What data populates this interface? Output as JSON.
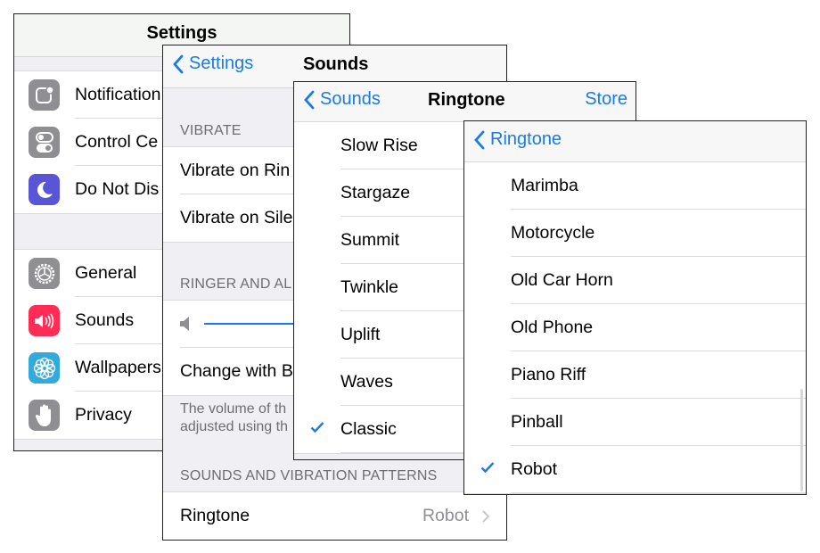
{
  "colors": {
    "accent": "#1a7ae6",
    "notifications_icon": "#8e8e93",
    "control_center_icon": "#8e8e93",
    "do_not_disturb_icon": "#5856d6",
    "general_icon": "#8e8e93",
    "sounds_icon": "#ff2d55",
    "wallpapers_icon": "#34aadc",
    "privacy_icon": "#8e8e93"
  },
  "settings": {
    "title": "Settings",
    "group1": [
      {
        "label": "Notification",
        "icon": "notifications-icon"
      },
      {
        "label": "Control Ce",
        "icon": "control-center-icon"
      },
      {
        "label": "Do Not Dis",
        "icon": "moon-icon"
      }
    ],
    "group2": [
      {
        "label": "General",
        "icon": "gear-icon"
      },
      {
        "label": "Sounds",
        "icon": "speaker-icon"
      },
      {
        "label": "Wallpapers",
        "icon": "flower-icon"
      },
      {
        "label": "Privacy",
        "icon": "hand-icon"
      }
    ]
  },
  "sounds": {
    "back_label": "Settings",
    "title": "Sounds",
    "vibrate_header": "VIBRATE",
    "vibrate_rows": [
      "Vibrate on Rin",
      "Vibrate on Sile"
    ],
    "ringer_header": "RINGER AND AL",
    "ringer_volume": 1.0,
    "change_with_buttons": "Change with B",
    "footer_line1": "The volume of th",
    "footer_line2": "adjusted using th",
    "patterns_header": "SOUNDS AND VIBRATION PATTERNS",
    "ringtone_label": "Ringtone",
    "ringtone_value": "Robot"
  },
  "ringtone": {
    "back_label": "Sounds",
    "title": "Ringtone",
    "store_label": "Store",
    "items": [
      {
        "label": "Slow Rise",
        "checked": false
      },
      {
        "label": "Stargaze",
        "checked": false
      },
      {
        "label": "Summit",
        "checked": false
      },
      {
        "label": "Twinkle",
        "checked": false
      },
      {
        "label": "Uplift",
        "checked": false
      },
      {
        "label": "Waves",
        "checked": false
      },
      {
        "label": "Classic",
        "checked": true
      }
    ]
  },
  "classic": {
    "back_label": "Ringtone",
    "items": [
      {
        "label": "Marimba",
        "checked": false
      },
      {
        "label": "Motorcycle",
        "checked": false
      },
      {
        "label": "Old Car Horn",
        "checked": false
      },
      {
        "label": "Old Phone",
        "checked": false
      },
      {
        "label": "Piano Riff",
        "checked": false
      },
      {
        "label": "Pinball",
        "checked": false
      },
      {
        "label": "Robot",
        "checked": true
      }
    ]
  }
}
